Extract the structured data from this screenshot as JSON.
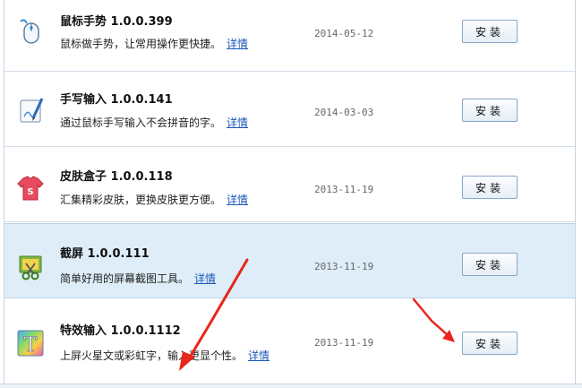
{
  "plugins": [
    {
      "name": "鼠标手势 1.0.0.399",
      "desc": "鼠标做手势，让常用操作更快捷。",
      "link": "详情",
      "date": "2014-05-12",
      "install_label": "安装",
      "icon": "mouse-icon",
      "selected": false
    },
    {
      "name": "手写输入 1.0.0.141",
      "desc": "通过鼠标手写输入不会拼音的字。",
      "link": "详情",
      "date": "2014-03-03",
      "install_label": "安装",
      "icon": "handwriting-pen-icon",
      "selected": false
    },
    {
      "name": "皮肤盒子 1.0.0.118",
      "desc": "汇集精彩皮肤，更换皮肤更方便。",
      "link": "详情",
      "date": "2013-11-19",
      "install_label": "安装",
      "icon": "skin-shirt-icon",
      "selected": false
    },
    {
      "name": "截屏 1.0.0.111",
      "desc": "简单好用的屏幕截图工具。",
      "link": "详情",
      "date": "2013-11-19",
      "install_label": "安装",
      "icon": "screenshot-scissors-icon",
      "selected": true
    },
    {
      "name": "特效输入 1.0.0.1112",
      "desc": "上屏火星文或彩虹字，输入更显个性。",
      "link": "详情",
      "date": "2013-11-19",
      "install_label": "安装",
      "icon": "rainbow-text-icon",
      "selected": false
    }
  ],
  "colors": {
    "selected_row": "#deedf8",
    "link": "#1a58b8",
    "arrow": "#e8261c"
  }
}
